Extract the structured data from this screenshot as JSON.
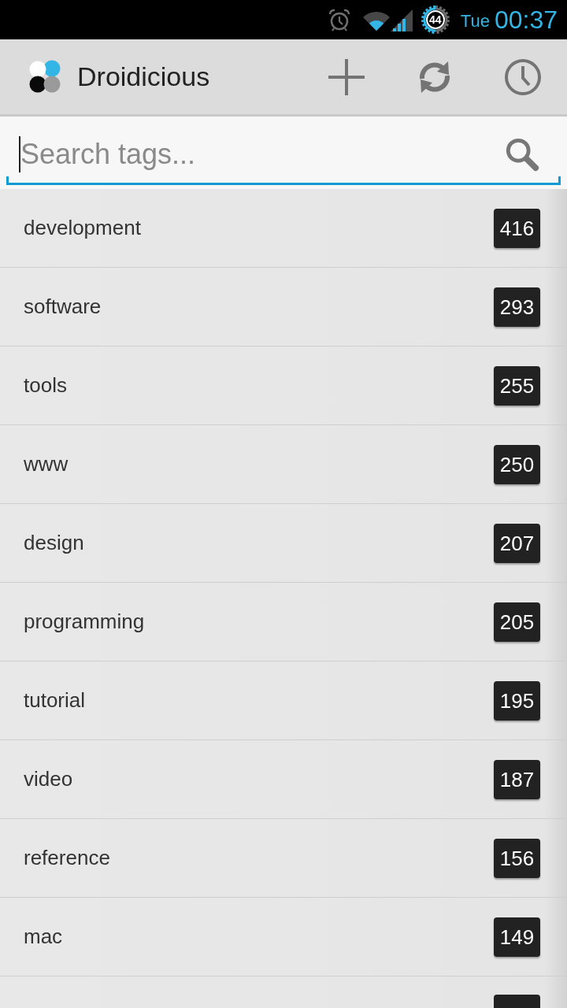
{
  "status_bar": {
    "battery": "44",
    "day": "Tue",
    "time": "00:37"
  },
  "action_bar": {
    "title": "Droidicious",
    "actions": [
      {
        "kind": "add"
      },
      {
        "kind": "sync"
      },
      {
        "kind": "history"
      }
    ]
  },
  "search": {
    "placeholder": "Search tags...",
    "focused": true
  },
  "tags": [
    {
      "label": "development",
      "count": "416"
    },
    {
      "label": "software",
      "count": "293"
    },
    {
      "label": "tools",
      "count": "255"
    },
    {
      "label": "www",
      "count": "250"
    },
    {
      "label": "design",
      "count": "207"
    },
    {
      "label": "programming",
      "count": "205"
    },
    {
      "label": "tutorial",
      "count": "195"
    },
    {
      "label": "video",
      "count": "187"
    },
    {
      "label": "reference",
      "count": "156"
    },
    {
      "label": "mac",
      "count": "149"
    }
  ]
}
